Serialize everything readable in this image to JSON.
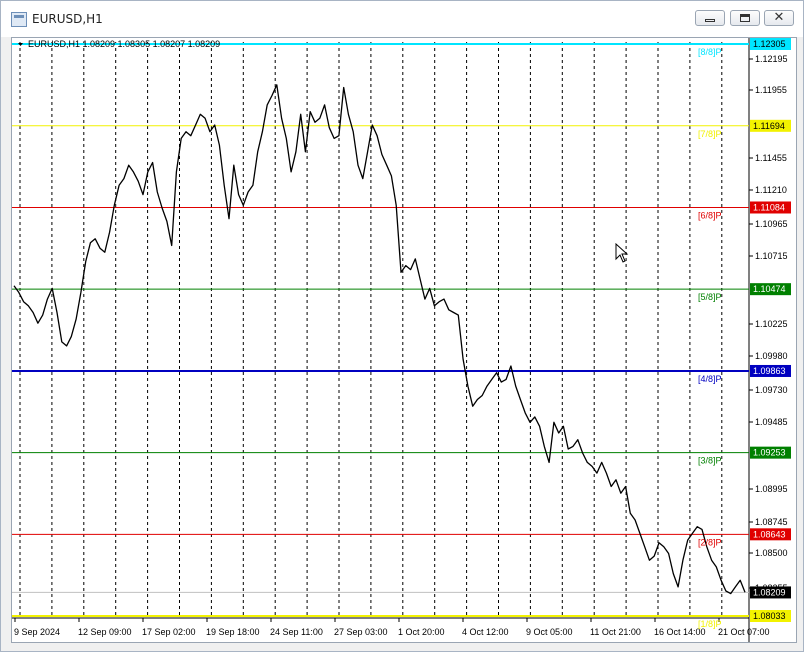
{
  "window": {
    "title": "EURUSD,H1",
    "close_glyph": "✕"
  },
  "chart_header": {
    "symbol_line": "EURUSD,H1  1.08209 1.08305 1.08207 1.08209"
  },
  "chart_data": {
    "type": "line",
    "symbol": "EURUSD",
    "timeframe": "H1",
    "ylim": [
      1.08,
      1.1235
    ],
    "price_ticks": [
      "1.12195",
      "1.11955",
      "1.11455",
      "1.11210",
      "1.10965",
      "1.10715",
      "1.10225",
      "1.09980",
      "1.09730",
      "1.09485",
      "1.08995",
      "1.08745",
      "1.08500",
      "1.08255"
    ],
    "date_ticks": [
      "9 Sep 2024",
      "12 Sep 09:00",
      "17 Sep 02:00",
      "19 Sep 18:00",
      "24 Sep 11:00",
      "27 Sep 03:00",
      "1 Oct 20:00",
      "4 Oct 12:00",
      "9 Oct 05:00",
      "11 Oct 21:00",
      "16 Oct 14:00",
      "21 Oct 07:00"
    ],
    "murrey_levels": [
      {
        "label": "[8/8]P",
        "price": 1.12305,
        "value": "1.12305",
        "color": "#00e5ff",
        "line_width": 2
      },
      {
        "label": "[7/8]P",
        "price": 1.11694,
        "value": "1.11694",
        "color": "#f2f200",
        "line_width": 1
      },
      {
        "label": "[6/8]P",
        "price": 1.11084,
        "value": "1.11084",
        "color": "#e00000",
        "line_width": 1
      },
      {
        "label": "[5/8]P",
        "price": 1.10474,
        "value": "1.10474",
        "color": "#008000",
        "line_width": 1
      },
      {
        "label": "[4/8]P",
        "price": 1.09863,
        "value": "1.09863",
        "color": "#0000c0",
        "line_width": 2
      },
      {
        "label": "[3/8]P",
        "price": 1.09253,
        "value": "1.09253",
        "color": "#008000",
        "line_width": 1
      },
      {
        "label": "[2/8]P",
        "price": 1.08643,
        "value": "1.08643",
        "color": "#e00000",
        "line_width": 1
      },
      {
        "label": "[1/8]P",
        "price": 1.08033,
        "value": "1.08033",
        "color": "#f2f200",
        "line_width": 2
      }
    ],
    "current_price": {
      "price": 1.08209,
      "value": "1.08209"
    },
    "series": [
      {
        "values": [
          1.105,
          1.1045,
          1.1038,
          1.1035,
          1.103,
          1.1022,
          1.1028,
          1.104,
          1.1048,
          1.103,
          1.1008,
          1.1005,
          1.1012,
          1.1025,
          1.1045,
          1.1068,
          1.1082,
          1.1085,
          1.1078,
          1.1075,
          1.109,
          1.111,
          1.1125,
          1.113,
          1.114,
          1.1135,
          1.1128,
          1.1118,
          1.1135,
          1.1142,
          1.112,
          1.1108,
          1.1098,
          1.108,
          1.1135,
          1.116,
          1.1165,
          1.1162,
          1.117,
          1.1178,
          1.1175,
          1.1165,
          1.117,
          1.1155,
          1.1125,
          1.11,
          1.114,
          1.1118,
          1.111,
          1.112,
          1.1125,
          1.115,
          1.1165,
          1.1185,
          1.1192,
          1.12,
          1.1175,
          1.116,
          1.1135,
          1.115,
          1.1178,
          1.115,
          1.118,
          1.1172,
          1.1175,
          1.1185,
          1.1168,
          1.116,
          1.1162,
          1.1198,
          1.1178,
          1.1165,
          1.114,
          1.113,
          1.115,
          1.117,
          1.1162,
          1.1148,
          1.114,
          1.1132,
          1.111,
          1.106,
          1.1065,
          1.1062,
          1.107,
          1.1055,
          1.104,
          1.1048,
          1.1035,
          1.1038,
          1.104,
          1.1032,
          1.103,
          1.1028,
          1.0995,
          1.0975,
          1.096,
          1.0965,
          1.0968,
          1.0975,
          1.098,
          1.0985,
          1.0978,
          1.098,
          1.099,
          1.0975,
          1.0965,
          1.0955,
          1.0948,
          1.0952,
          1.0945,
          1.093,
          1.0918,
          1.0948,
          1.094,
          1.0945,
          1.0928,
          1.093,
          1.0935,
          1.0925,
          1.0918,
          1.0915,
          1.091,
          1.0918,
          1.091,
          1.09,
          1.0905,
          1.0895,
          1.09,
          1.088,
          1.0875,
          1.0865,
          1.0855,
          1.0845,
          1.0848,
          1.0858,
          1.0855,
          1.085,
          1.0835,
          1.0825,
          1.0845,
          1.086,
          1.0865,
          1.087,
          1.0868,
          1.0855,
          1.0845,
          1.084,
          1.083,
          1.0822,
          1.082,
          1.0825,
          1.083,
          1.0821
        ]
      }
    ],
    "grid": true
  }
}
